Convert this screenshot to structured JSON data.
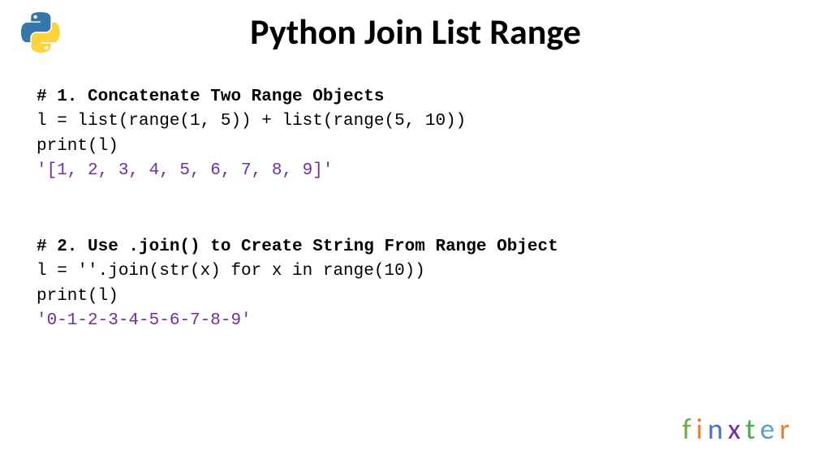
{
  "title": "Python Join List Range",
  "block1": {
    "comment": "# 1. Concatenate Two Range Objects",
    "line1": "l = list(range(1, 5)) + list(range(5, 10))",
    "line2": "print(l)",
    "output": "'[1, 2, 3, 4, 5, 6, 7, 8, 9]'"
  },
  "block2": {
    "comment": "# 2. Use .join() to Create String From Range Object",
    "line1": "l = ''.join(str(x) for x in range(10))",
    "line2": "print(l)",
    "output": "'0-1-2-3-4-5-6-7-8-9'"
  },
  "brand": {
    "f": "f",
    "i": "i",
    "n": "n",
    "x": "x",
    "t": "t",
    "e": "e",
    "r": "r"
  }
}
